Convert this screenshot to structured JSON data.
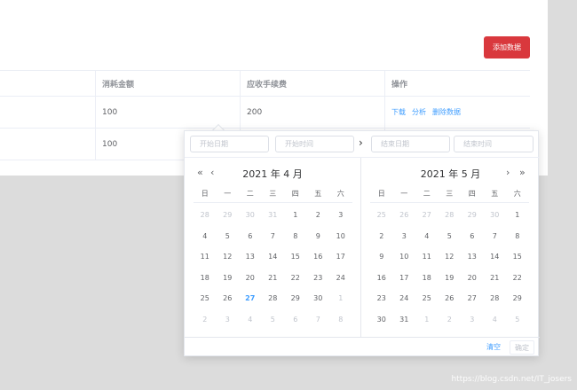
{
  "toolbar": {
    "add_label": "添加数据"
  },
  "table": {
    "headers": [
      "",
      "消耗金额",
      "应收手续费",
      "操作"
    ],
    "rows": [
      {
        "c0": "",
        "amount": "100",
        "fee": "200",
        "actions": [
          "下载",
          "分析",
          "删除数据"
        ]
      },
      {
        "c0": "",
        "amount": "100",
        "fee": "",
        "actions": []
      }
    ]
  },
  "picker": {
    "start_date_placeholder": "开始日期",
    "start_time_placeholder": "开始时间",
    "end_date_placeholder": "结束日期",
    "end_time_placeholder": "结束时间",
    "separator": "›",
    "weekdays": [
      "日",
      "一",
      "二",
      "三",
      "四",
      "五",
      "六"
    ],
    "left": {
      "title": "2021 年 4 月",
      "nav_prev_year": "«",
      "nav_prev_month": "‹",
      "weeks": [
        [
          [
            "28",
            "muted"
          ],
          [
            "29",
            "muted"
          ],
          [
            "30",
            "muted"
          ],
          [
            "31",
            "muted"
          ],
          [
            "1",
            ""
          ],
          [
            "2",
            ""
          ],
          [
            "3",
            ""
          ]
        ],
        [
          [
            "4",
            ""
          ],
          [
            "5",
            ""
          ],
          [
            "6",
            ""
          ],
          [
            "7",
            ""
          ],
          [
            "8",
            ""
          ],
          [
            "9",
            ""
          ],
          [
            "10",
            ""
          ]
        ],
        [
          [
            "11",
            ""
          ],
          [
            "12",
            ""
          ],
          [
            "13",
            ""
          ],
          [
            "14",
            ""
          ],
          [
            "15",
            ""
          ],
          [
            "16",
            ""
          ],
          [
            "17",
            ""
          ]
        ],
        [
          [
            "18",
            ""
          ],
          [
            "19",
            ""
          ],
          [
            "20",
            ""
          ],
          [
            "21",
            ""
          ],
          [
            "22",
            ""
          ],
          [
            "23",
            ""
          ],
          [
            "24",
            ""
          ]
        ],
        [
          [
            "25",
            ""
          ],
          [
            "26",
            ""
          ],
          [
            "27",
            "today"
          ],
          [
            "28",
            ""
          ],
          [
            "29",
            ""
          ],
          [
            "30",
            ""
          ],
          [
            "1",
            "muted"
          ]
        ],
        [
          [
            "2",
            "muted"
          ],
          [
            "3",
            "muted"
          ],
          [
            "4",
            "muted"
          ],
          [
            "5",
            "muted"
          ],
          [
            "6",
            "muted"
          ],
          [
            "7",
            "muted"
          ],
          [
            "8",
            "muted"
          ]
        ]
      ]
    },
    "right": {
      "title": "2021 年 5 月",
      "nav_next_month": "›",
      "nav_next_year": "»",
      "weeks": [
        [
          [
            "25",
            "muted"
          ],
          [
            "26",
            "muted"
          ],
          [
            "27",
            "muted"
          ],
          [
            "28",
            "muted"
          ],
          [
            "29",
            "muted"
          ],
          [
            "30",
            "muted"
          ],
          [
            "1",
            ""
          ]
        ],
        [
          [
            "2",
            ""
          ],
          [
            "3",
            ""
          ],
          [
            "4",
            ""
          ],
          [
            "5",
            ""
          ],
          [
            "6",
            ""
          ],
          [
            "7",
            ""
          ],
          [
            "8",
            ""
          ]
        ],
        [
          [
            "9",
            ""
          ],
          [
            "10",
            ""
          ],
          [
            "11",
            ""
          ],
          [
            "12",
            ""
          ],
          [
            "13",
            ""
          ],
          [
            "14",
            ""
          ],
          [
            "15",
            ""
          ]
        ],
        [
          [
            "16",
            ""
          ],
          [
            "17",
            ""
          ],
          [
            "18",
            ""
          ],
          [
            "19",
            ""
          ],
          [
            "20",
            ""
          ],
          [
            "21",
            ""
          ],
          [
            "22",
            ""
          ]
        ],
        [
          [
            "23",
            ""
          ],
          [
            "24",
            ""
          ],
          [
            "25",
            ""
          ],
          [
            "26",
            ""
          ],
          [
            "27",
            ""
          ],
          [
            "28",
            ""
          ],
          [
            "29",
            ""
          ]
        ],
        [
          [
            "30",
            ""
          ],
          [
            "31",
            ""
          ],
          [
            "1",
            "muted"
          ],
          [
            "2",
            "muted"
          ],
          [
            "3",
            "muted"
          ],
          [
            "4",
            "muted"
          ],
          [
            "5",
            "muted"
          ]
        ]
      ]
    },
    "clear_label": "清空",
    "confirm_label": "确定"
  },
  "watermark": "https://blog.csdn.net/IT_josers"
}
